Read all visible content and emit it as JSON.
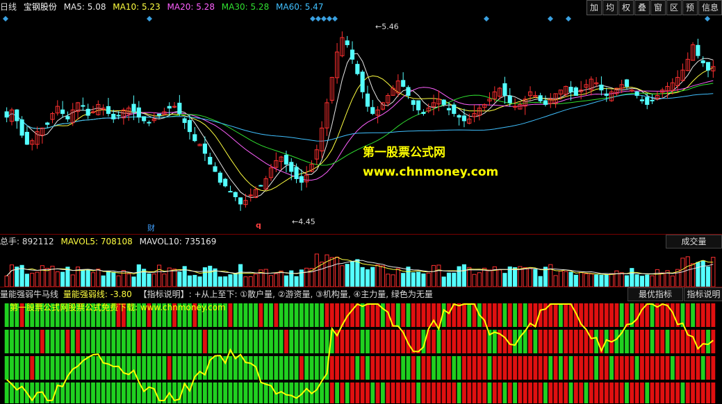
{
  "price_header": {
    "period": "日线",
    "stock": "宝钢股份",
    "ma5": "MA5: 5.08",
    "ma10": "MA10: 5.23",
    "ma20": "MA20: 5.28",
    "ma30": "MA30: 5.28",
    "ma60": "MA60: 5.47"
  },
  "toolbar": [
    "加",
    "均",
    "权",
    "叠",
    "窗",
    "区",
    "预",
    "信息"
  ],
  "price_labels": {
    "high": "5.46",
    "low": "4.45",
    "cai": "财",
    "q": "q"
  },
  "watermark": {
    "line1": "第一股票公式网",
    "line2": "www.chnmoney.com"
  },
  "vol_header": {
    "total": "总手: 892112",
    "mavol5": "MAVOL5: 708108",
    "mavol10": "MAVOL10: 735169",
    "tab": "成交量"
  },
  "ind_header": {
    "name": "量能强弱牛马线",
    "value": "量能强弱线: -3.80",
    "desc": "【指标说明】: +从上至下: ①散户量, ②游资量, ③机构量, ④主力量, 绿色为无量",
    "tab1": "最优指标",
    "tab2": "指标说明",
    "watermark": "第一股票公式网股票公式免费下载: www.chnmoney.com"
  },
  "colors": {
    "up": "#ff3030",
    "down": "#54ffff",
    "ma5": "#e8e8e8",
    "ma10": "#ffff40",
    "ma20": "#ff60ff",
    "ma30": "#30e030",
    "ma60": "#40c0ff"
  },
  "chart_data": {
    "type": "candlestick",
    "ylim": [
      4.4,
      5.52
    ],
    "closes": [
      4.98,
      5.02,
      4.96,
      4.88,
      4.83,
      4.85,
      4.9,
      4.92,
      4.94,
      5.0,
      5.04,
      5.0,
      4.97,
      5.02,
      5.06,
      5.04,
      4.99,
      5.01,
      5.05,
      5.03,
      5.0,
      4.97,
      4.99,
      5.02,
      5.03,
      5.01,
      4.98,
      4.96,
      4.95,
      4.97,
      4.99,
      5.01,
      5.03,
      5.04,
      5.0,
      4.95,
      4.9,
      4.85,
      4.83,
      4.78,
      4.72,
      4.68,
      4.62,
      4.6,
      4.57,
      4.54,
      4.5,
      4.52,
      4.55,
      4.58,
      4.6,
      4.64,
      4.7,
      4.74,
      4.76,
      4.72,
      4.68,
      4.64,
      4.62,
      4.66,
      4.72,
      4.8,
      4.92,
      5.06,
      5.2,
      5.34,
      5.42,
      5.38,
      5.3,
      5.22,
      5.12,
      5.04,
      5.0,
      5.02,
      5.06,
      5.1,
      5.14,
      5.18,
      5.15,
      5.1,
      5.05,
      5.02,
      5.0,
      5.03,
      5.06,
      5.08,
      5.05,
      5.02,
      5.0,
      4.98,
      4.96,
      4.97,
      5.0,
      5.03,
      5.05,
      5.08,
      5.12,
      5.14,
      5.1,
      5.06,
      5.04,
      5.05,
      5.08,
      5.12,
      5.1,
      5.07,
      5.05,
      5.08,
      5.11,
      5.13,
      5.15,
      5.12,
      5.1,
      5.13,
      5.16,
      5.19,
      5.17,
      5.13,
      5.1,
      5.12,
      5.14,
      5.16,
      5.15,
      5.13,
      5.1,
      5.07,
      5.05,
      5.07,
      5.1,
      5.13,
      5.15,
      5.17,
      5.2,
      5.24,
      5.3,
      5.38,
      5.32,
      5.28,
      5.24,
      5.26
    ],
    "volume_label": "总手: 892112"
  }
}
